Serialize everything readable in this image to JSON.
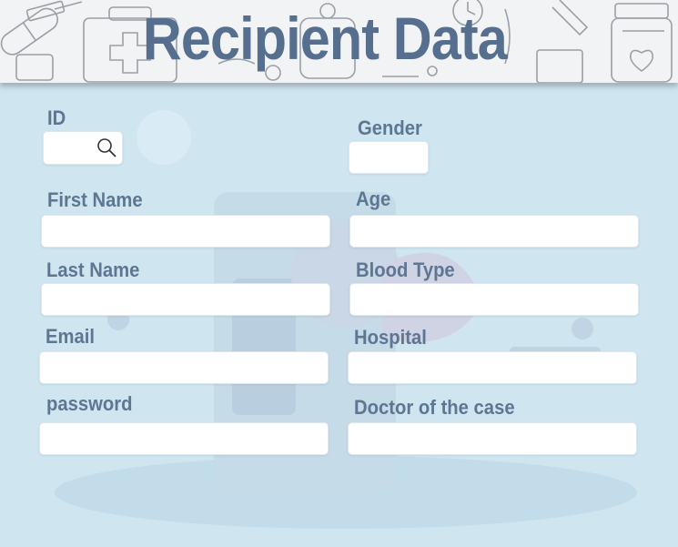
{
  "header": {
    "title": "Recipient Data"
  },
  "form": {
    "id": {
      "label": "ID",
      "value": ""
    },
    "gender": {
      "label": "Gender",
      "value": ""
    },
    "first_name": {
      "label": "First Name",
      "value": ""
    },
    "age": {
      "label": "Age",
      "value": ""
    },
    "last_name": {
      "label": "Last Name",
      "value": ""
    },
    "blood_type": {
      "label": "Blood Type",
      "value": ""
    },
    "email": {
      "label": "Email",
      "value": ""
    },
    "hospital": {
      "label": "Hospital",
      "value": ""
    },
    "password": {
      "label": "password",
      "value": ""
    },
    "doctor": {
      "label": "Doctor of the case",
      "value": ""
    }
  },
  "icons": {
    "search": "search-icon"
  },
  "colors": {
    "background": "#cfe6f1",
    "title": "#566f8e",
    "label": "#5d7692"
  }
}
